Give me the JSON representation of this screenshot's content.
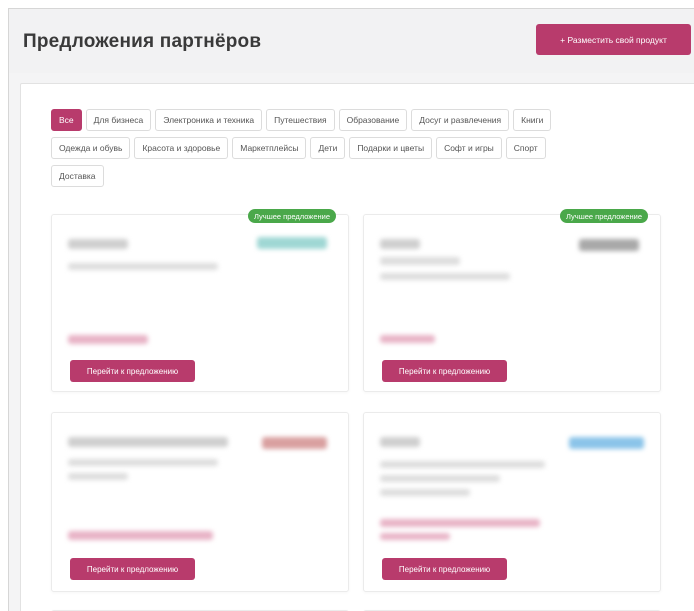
{
  "header": {
    "title": "Предложения партнёров",
    "place_button": "+ Разместить свой продукт"
  },
  "filters": {
    "rows": [
      [
        "Все",
        "Для бизнеса",
        "Электроника и техника",
        "Путешествия",
        "Образование",
        "Досуг и развлечения",
        "Книги"
      ],
      [
        "Одежда и обувь",
        "Красота и здоровье",
        "Маркетплейсы",
        "Дети",
        "Подарки и цветы",
        "Софт и игры",
        "Спорт"
      ],
      [
        "Доставка"
      ]
    ],
    "active": "Все"
  },
  "cards": [
    {
      "badge": "Лучшее предложение",
      "button": "Перейти к предложению"
    },
    {
      "badge": "Лучшее предложение",
      "button": "Перейти к предложению"
    },
    {
      "button": "Перейти к предложению"
    },
    {
      "button": "Перейти к предложению"
    }
  ],
  "colors": {
    "accent": "#b83b6c",
    "badge": "#4aa84a"
  }
}
